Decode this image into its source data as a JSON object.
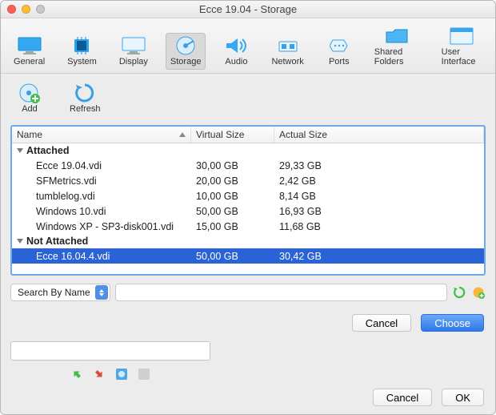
{
  "title": "Ecce 19.04 - Storage",
  "tabs": [
    {
      "label": "General"
    },
    {
      "label": "System"
    },
    {
      "label": "Display"
    },
    {
      "label": "Storage"
    },
    {
      "label": "Audio"
    },
    {
      "label": "Network"
    },
    {
      "label": "Ports"
    },
    {
      "label": "Shared Folders"
    },
    {
      "label": "User Interface"
    }
  ],
  "selected_tab": "Storage",
  "sub_actions": {
    "add": "Add",
    "refresh": "Refresh"
  },
  "columns": {
    "name": "Name",
    "vs": "Virtual Size",
    "as": "Actual Size"
  },
  "groups": [
    {
      "label": "Attached",
      "rows": [
        {
          "name": "Ecce 19.04.vdi",
          "vs": "30,00 GB",
          "as": "29,33 GB"
        },
        {
          "name": "SFMetrics.vdi",
          "vs": "20,00 GB",
          "as": "2,42 GB"
        },
        {
          "name": "tumblelog.vdi",
          "vs": "10,00 GB",
          "as": "8,14 GB"
        },
        {
          "name": "Windows 10.vdi",
          "vs": "50,00 GB",
          "as": "16,93 GB"
        },
        {
          "name": "Windows XP - SP3-disk001.vdi",
          "vs": "15,00 GB",
          "as": "11,68 GB"
        }
      ]
    },
    {
      "label": "Not Attached",
      "rows": [
        {
          "name": "Ecce 16.04.4.vdi",
          "vs": "50,00 GB",
          "as": "30,42 GB",
          "selected": true
        }
      ]
    }
  ],
  "search": {
    "mode": "Search By Name",
    "value": ""
  },
  "dialog_buttons": {
    "cancel": "Cancel",
    "choose": "Choose"
  },
  "footer_buttons": {
    "cancel": "Cancel",
    "ok": "OK"
  }
}
